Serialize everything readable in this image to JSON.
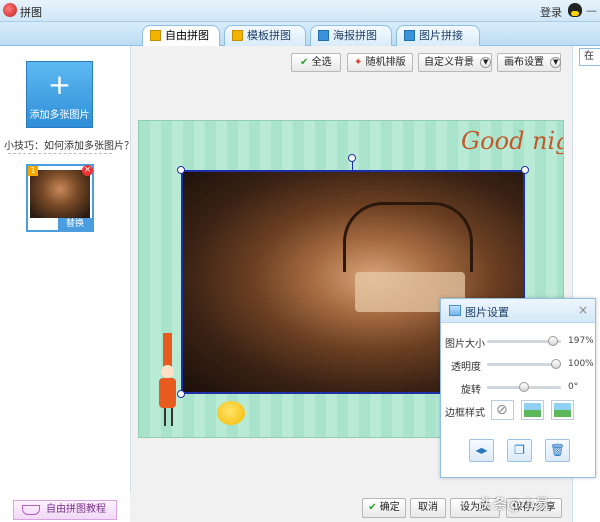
{
  "window": {
    "title": "拼图",
    "login": "登录",
    "minimize": "—"
  },
  "tabs": [
    {
      "label": "自由拼图",
      "active": true
    },
    {
      "label": "模板拼图",
      "active": false
    },
    {
      "label": "海报拼图",
      "active": false
    },
    {
      "label": "图片拼接",
      "active": false
    }
  ],
  "sidebar": {
    "add_button": "添加多张图片",
    "add_plus": "+",
    "tip": "小技巧：如何添加多张图片？",
    "thumb_number": "1",
    "thumb_delete": "×",
    "thumb_replace": "替换",
    "tutorial": "自由拼图教程"
  },
  "toolbar": {
    "select_all": "全选",
    "random_layout": "随机排版",
    "custom_background": "自定义背景",
    "canvas_settings": "画布设置"
  },
  "canvas": {
    "decoration_text": "Good night"
  },
  "image_settings": {
    "title": "图片设置",
    "close": "×",
    "size_label": "图片大小",
    "size_value": "197%",
    "size_fraction": 0.95,
    "opacity_label": "透明度",
    "opacity_value": "100%",
    "opacity_fraction": 1.0,
    "rotate_label": "旋转",
    "rotate_value": "0°",
    "rotate_fraction": 0.5,
    "border_label": "边框样式"
  },
  "right_panel": {
    "tab": "在"
  },
  "bottom": {
    "confirm": "确定",
    "cancel": "取消",
    "set_background": "设为底",
    "save_share": "保存/分享"
  },
  "watermark": "头条@小易"
}
